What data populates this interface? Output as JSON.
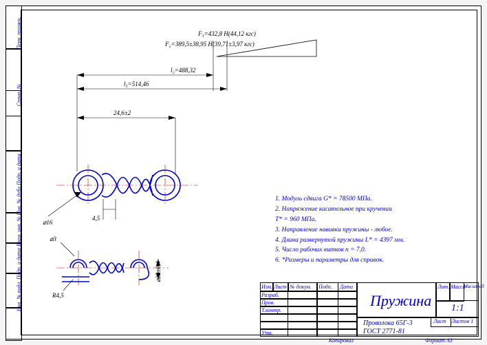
{
  "dims": {
    "l2": "l₂=488,32",
    "l3": "l₃=514,46",
    "L": "24,6±2",
    "d_outer": "⌀16",
    "gap": "4,5",
    "d_wire": "⌀3",
    "R": "R4,5",
    "d_inner": "⌀22±0,4"
  },
  "forces": {
    "F3": "F₃=432,8 Н(44,12 кгс)",
    "F2": "F₂=389,5±38,95 Н(39,71±3,97 кгс)"
  },
  "notes": {
    "n1": "1. Модуль сдвига G* = 78500 МПа.",
    "n2": "2. Напряжение касательное при кручении",
    "n2b": "   Т* = 960 МПа.",
    "n3": "3. Направление навивки пружины - любое.",
    "n4": "4. Длина развернутой пружины L* = 4397 мм.",
    "n5": "5. Число рабочих витков n = 7,0.",
    "n6": "6. *Размеры и параметры для справок."
  },
  "titleblock": {
    "name": "Пружина",
    "material": "Проволока 65Г-3",
    "gost": "ГОСТ 2771-81",
    "scale": "1:1",
    "sheet": "Лист",
    "sheets": "Листов   1",
    "mass": "Масса",
    "scale_h": "Масштаб",
    "lit": "Лит.",
    "format": "Формат   А3",
    "copy": "Копировал",
    "headers": {
      "izm": "Изм.",
      "list": "Лист",
      "ndoc": "№ докум.",
      "podp": "Подп.",
      "data": "Дата"
    },
    "rows": {
      "razrab": "Разраб.",
      "prov": "Пров.",
      "tkontr": "Т.контр.",
      "utv": "Утв."
    }
  },
  "sidebar": {
    "s1": "Инв. № подл.",
    "s2": "Подп. и дата",
    "s3": "Взам. инв. №",
    "s4": "Инв. № дубл.",
    "s5": "Подп. и дата",
    "s6": "Справ. №",
    "s7": "Перв. примен."
  }
}
